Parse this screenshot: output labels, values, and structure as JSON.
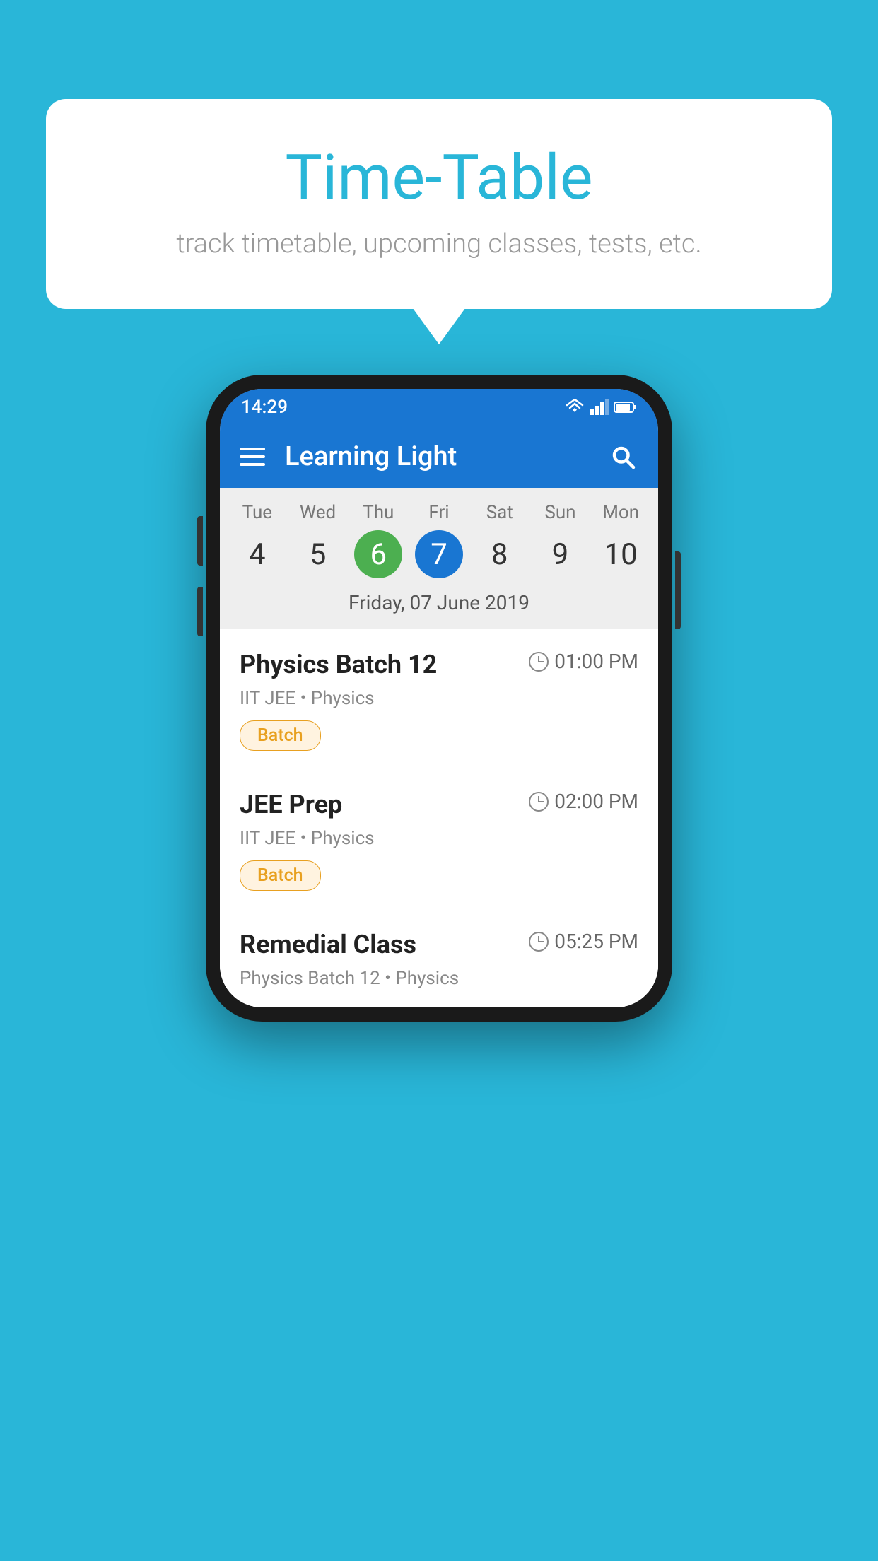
{
  "background_color": "#29b6d8",
  "speech_bubble": {
    "title": "Time-Table",
    "subtitle": "track timetable, upcoming classes, tests, etc."
  },
  "phone": {
    "status_bar": {
      "time": "14:29",
      "icons": [
        "wifi",
        "signal",
        "battery"
      ]
    },
    "app_header": {
      "title": "Learning Light"
    },
    "calendar": {
      "days": [
        {
          "name": "Tue",
          "number": "4",
          "state": "normal"
        },
        {
          "name": "Wed",
          "number": "5",
          "state": "normal"
        },
        {
          "name": "Thu",
          "number": "6",
          "state": "today"
        },
        {
          "name": "Fri",
          "number": "7",
          "state": "selected"
        },
        {
          "name": "Sat",
          "number": "8",
          "state": "normal"
        },
        {
          "name": "Sun",
          "number": "9",
          "state": "normal"
        },
        {
          "name": "Mon",
          "number": "10",
          "state": "normal"
        }
      ],
      "selected_date_label": "Friday, 07 June 2019"
    },
    "schedule_items": [
      {
        "title": "Physics Batch 12",
        "time": "01:00 PM",
        "subtitle": "IIT JEE • Physics",
        "badge": "Batch"
      },
      {
        "title": "JEE Prep",
        "time": "02:00 PM",
        "subtitle": "IIT JEE • Physics",
        "badge": "Batch"
      },
      {
        "title": "Remedial Class",
        "time": "05:25 PM",
        "subtitle": "Physics Batch 12 • Physics",
        "badge": null
      }
    ]
  }
}
